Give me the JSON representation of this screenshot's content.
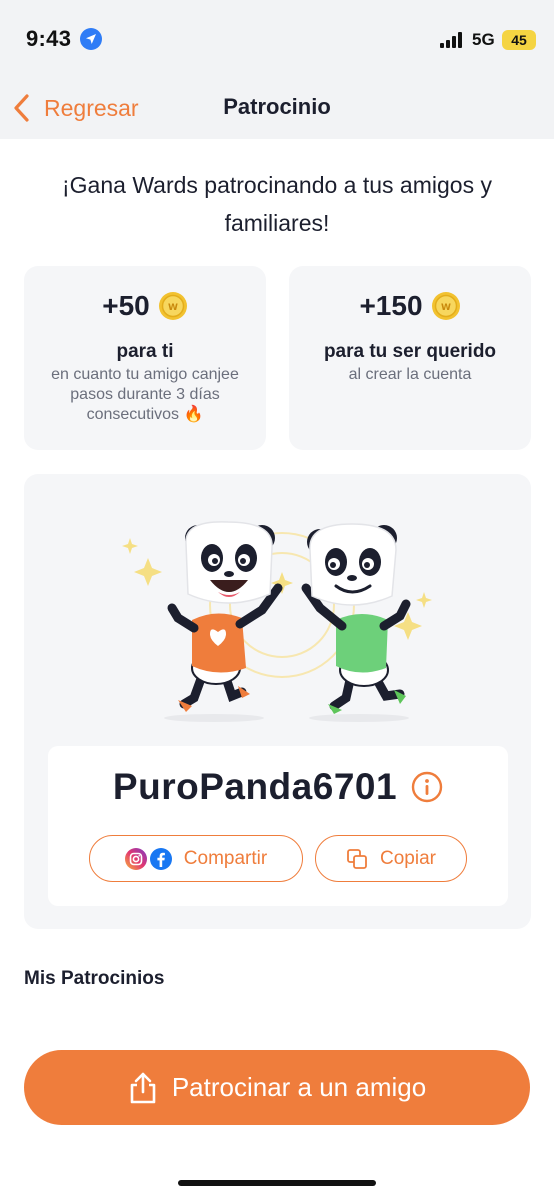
{
  "status_bar": {
    "time": "9:43",
    "network": "5G",
    "battery": "45",
    "icons": [
      "location-arrow-icon",
      "signal-bars-icon",
      "battery-icon"
    ]
  },
  "nav": {
    "back_label": "Regresar",
    "title": "Patrocinio"
  },
  "headline": "¡Gana Wards patrocinando a tus amigos y familiares!",
  "rewards": [
    {
      "amount": "+50",
      "title": "para ti",
      "description": "en cuanto tu amigo canjee pasos durante 3 días consecutivos 🔥",
      "icon": "ward-coin-icon"
    },
    {
      "amount": "+150",
      "title": "para tu ser querido",
      "description": "al crear la cuenta",
      "icon": "ward-coin-icon"
    }
  ],
  "referral": {
    "code": "PuroPanda6701",
    "share_label": "Compartir",
    "copy_label": "Copiar"
  },
  "section": {
    "title": "Mis Patrocinios"
  },
  "cta": {
    "label": "Patrocinar a un amigo",
    "icon": "share-upload-icon"
  },
  "colors": {
    "accent": "#ef7d3c",
    "card_bg": "#f5f6f8",
    "text_dark": "#1c1f2e",
    "text_muted": "#6b6f7c",
    "coin": "#f2c230"
  }
}
